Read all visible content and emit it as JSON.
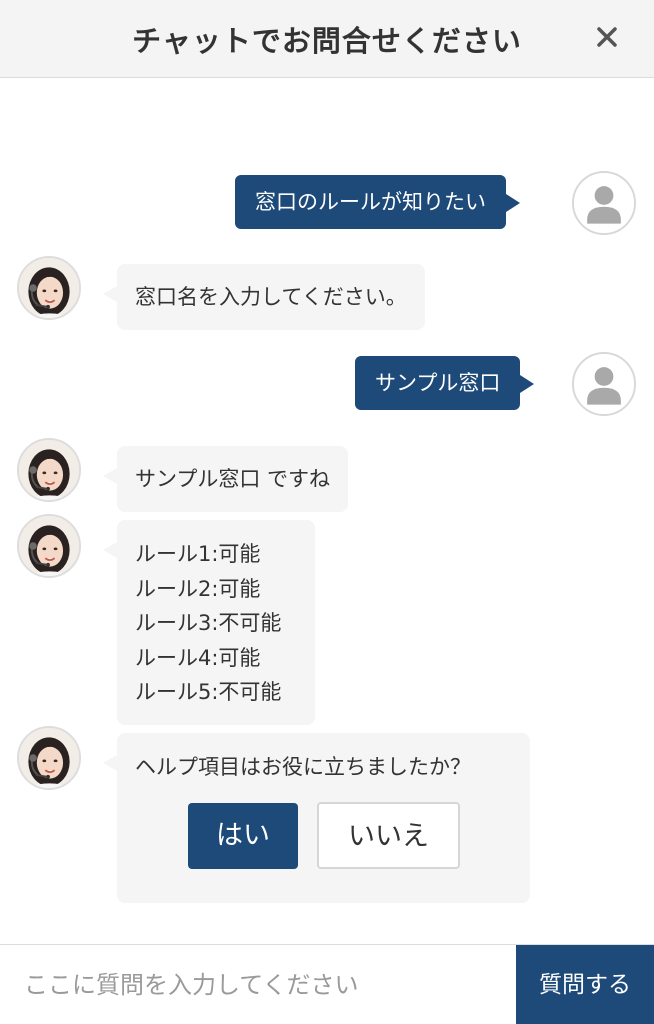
{
  "header": {
    "title": "チャットでお問合せください",
    "close_icon": "close-icon"
  },
  "messages": [
    {
      "from": "user",
      "text": "窓口のルールが知りたい"
    },
    {
      "from": "operator",
      "text": "窓口名を入力してください。"
    },
    {
      "from": "user",
      "text": "サンプル窓口"
    },
    {
      "from": "operator",
      "text": "サンプル窓口 ですね"
    },
    {
      "from": "operator",
      "lines": [
        "ルール1:可能",
        "ルール2:可能",
        "ルール3:不可能",
        "ルール4:可能",
        "ルール5:不可能"
      ]
    },
    {
      "from": "operator",
      "text": "ヘルプ項目はお役に立ちましたか？",
      "buttons": {
        "yes": "はい",
        "no": "いいえ"
      }
    }
  ],
  "input": {
    "placeholder": "ここに質問を入力してください",
    "value": "",
    "send_label": "質問する"
  },
  "colors": {
    "accent": "#1d4a79",
    "bot_bubble": "#f5f5f5",
    "header_bg": "#f4f4f4"
  }
}
